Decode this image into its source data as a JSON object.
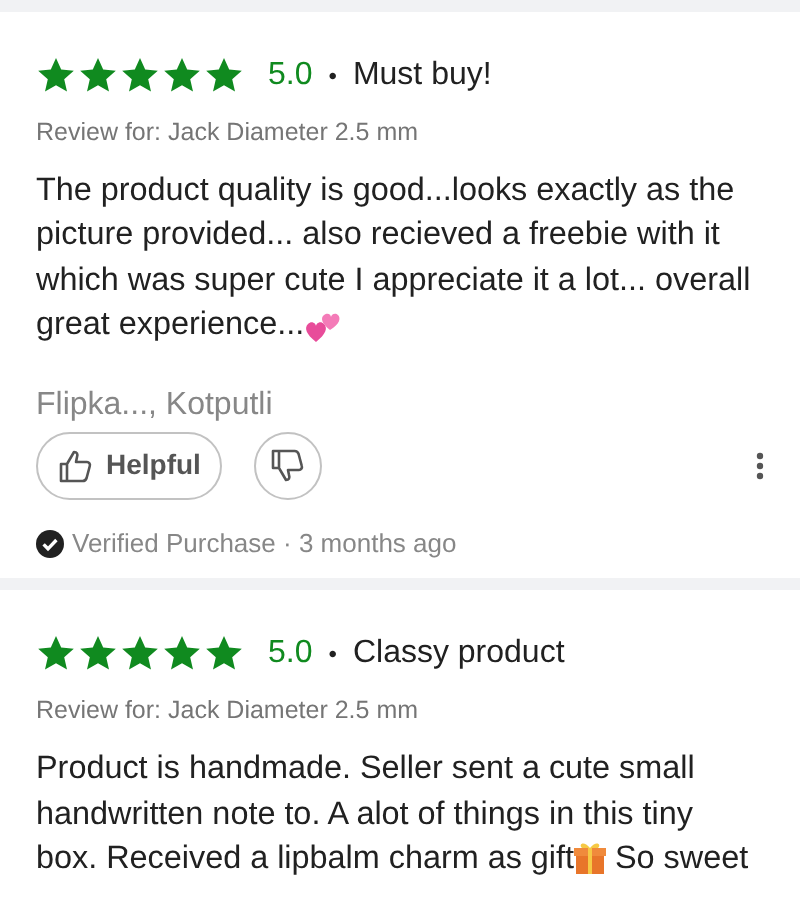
{
  "reviews": [
    {
      "stars": 5,
      "rating": "5.0",
      "separator": "•",
      "title": "Must buy!",
      "review_for": "Review for: Jack Diameter 2.5 mm",
      "body_lines": [
        [
          {
            "kind": "text",
            "text": "The product quality is good...looks exactly as the"
          }
        ],
        [
          {
            "kind": "text",
            "text": "picture provided... also recieved a freebie with it"
          }
        ],
        [
          {
            "kind": "text",
            "text": "which was super cute I appreciate it a lot... overall"
          }
        ],
        [
          {
            "kind": "text",
            "text": "great experience..."
          },
          {
            "kind": "hearts-emoji"
          }
        ]
      ],
      "author": "Flipka..., Kotputli",
      "helpful_label": "Helpful",
      "verified": "Verified Purchase · 3 months ago"
    },
    {
      "stars": 5,
      "rating": "5.0",
      "separator": "•",
      "title": "Classy product",
      "review_for": "Review for: Jack Diameter 2.5 mm",
      "body_lines": [
        [
          {
            "kind": "text",
            "text": "Product is handmade. Seller sent a cute small"
          }
        ],
        [
          {
            "kind": "text",
            "text": "handwritten note to. A alot of things in this tiny"
          }
        ],
        [
          {
            "kind": "text",
            "text": "box. Received a lipbalm charm as gift"
          },
          {
            "kind": "gift-emoji"
          },
          {
            "kind": "text",
            "text": " So sweet"
          }
        ]
      ]
    }
  ]
}
